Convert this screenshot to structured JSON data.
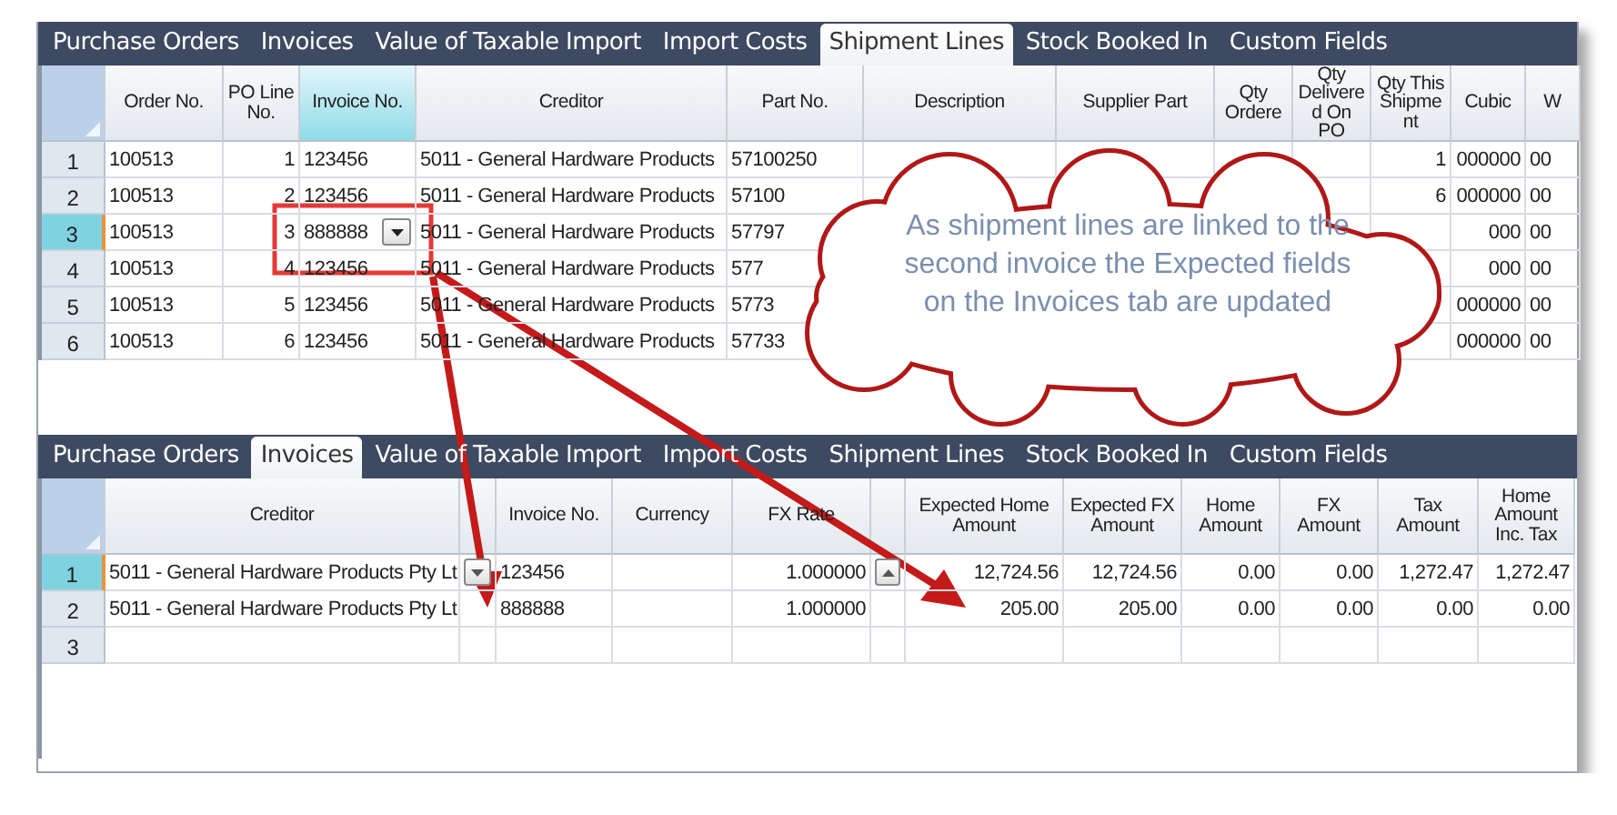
{
  "panels": [
    {
      "tabs": [
        {
          "label": "Purchase Orders",
          "selected": false
        },
        {
          "label": "Invoices",
          "selected": false
        },
        {
          "label": "Value of Taxable Import",
          "selected": false
        },
        {
          "label": "Import Costs",
          "selected": false
        },
        {
          "label": "Shipment Lines",
          "selected": true
        },
        {
          "label": "Stock Booked In",
          "selected": false
        },
        {
          "label": "Custom Fields",
          "selected": false
        }
      ],
      "columns": [
        {
          "header": "Order No.",
          "selected": false
        },
        {
          "header": "PO Line No.",
          "selected": false
        },
        {
          "header": "Invoice No.",
          "selected": true
        },
        {
          "header": "Creditor",
          "selected": false
        },
        {
          "header": "Part No.",
          "selected": false
        },
        {
          "header": "Description",
          "selected": false
        },
        {
          "header": "Supplier Part",
          "selected": false
        },
        {
          "header": "Qty Ordere",
          "selected": false
        },
        {
          "header": "Qty Delivered On PO",
          "selected": false
        },
        {
          "header": "Qty This Shipment",
          "selected": false
        },
        {
          "header": "Cubic",
          "selected": false
        },
        {
          "header": "W",
          "selected": false
        }
      ],
      "rows": [
        {
          "number": "1",
          "selected": false,
          "cells": [
            {
              "text": "100513"
            },
            {
              "text": "1"
            },
            {
              "text": "123456"
            },
            {
              "text": "5011 - General Hardware Products"
            },
            {
              "text": "57100250"
            },
            {},
            {},
            {},
            {},
            {
              "text": "1"
            },
            {
              "text": "000000"
            },
            {
              "text": "00"
            }
          ]
        },
        {
          "number": "2",
          "selected": false,
          "cells": [
            {
              "text": "100513"
            },
            {
              "text": "2"
            },
            {
              "text": "123456"
            },
            {
              "text": "5011 - General Hardware Products"
            },
            {
              "text": "57100"
            },
            {},
            {},
            {},
            {},
            {
              "text": "6"
            },
            {
              "text": "000000"
            },
            {
              "text": "00"
            }
          ]
        },
        {
          "number": "3",
          "selected": true,
          "cells": [
            {
              "text": "100513"
            },
            {
              "text": "3"
            },
            {
              "text": "888888",
              "kind": "combo"
            },
            {
              "text": "5011 - General Hardware Products"
            },
            {
              "text": "57797"
            },
            {},
            {},
            {},
            {},
            {},
            {
              "text": "000"
            },
            {
              "text": "00"
            }
          ]
        },
        {
          "number": "4",
          "selected": false,
          "cells": [
            {
              "text": "100513"
            },
            {
              "text": "4"
            },
            {
              "text": "123456"
            },
            {
              "text": "5011 - General Hardware Products"
            },
            {
              "text": "577"
            },
            {},
            {},
            {},
            {},
            {},
            {
              "text": "000"
            },
            {
              "text": "00"
            }
          ]
        },
        {
          "number": "5",
          "selected": false,
          "cells": [
            {
              "text": "100513"
            },
            {
              "text": "5"
            },
            {
              "text": "123456"
            },
            {
              "text": "5011 - General Hardware Products"
            },
            {
              "text": "5773"
            },
            {},
            {},
            {},
            {},
            {},
            {
              "text": "000000"
            },
            {
              "text": "00"
            }
          ]
        },
        {
          "number": "6",
          "selected": false,
          "cells": [
            {
              "text": "100513"
            },
            {
              "text": "6"
            },
            {
              "text": "123456"
            },
            {
              "text": "5011 - General Hardware Products"
            },
            {
              "text": "57733"
            },
            {},
            {},
            {},
            {},
            {},
            {
              "text": "000000"
            },
            {
              "text": "00"
            }
          ]
        }
      ]
    },
    {
      "tabs": [
        {
          "label": "Purchase Orders",
          "selected": false
        },
        {
          "label": "Invoices",
          "selected": true
        },
        {
          "label": "Value of Taxable Import",
          "selected": false
        },
        {
          "label": "Import Costs",
          "selected": false
        },
        {
          "label": "Shipment Lines",
          "selected": false
        },
        {
          "label": "Stock Booked In",
          "selected": false
        },
        {
          "label": "Custom Fields",
          "selected": false
        }
      ],
      "columns": [
        {
          "header": "Creditor",
          "selected": false
        },
        {
          "selected": false
        },
        {
          "header": "Invoice No.",
          "selected": false
        },
        {
          "header": "Currency",
          "selected": false
        },
        {
          "header": "FX Rate",
          "selected": false
        },
        {
          "selected": false
        },
        {
          "header": "Expected Home Amount",
          "selected": false
        },
        {
          "header": "Expected FX Amount",
          "selected": false
        },
        {
          "header": "Home Amount",
          "selected": false
        },
        {
          "header": "FX Amount",
          "selected": false
        },
        {
          "header": "Tax Amount",
          "selected": false
        },
        {
          "header": "Home Amount Inc. Tax",
          "selected": false
        }
      ],
      "rows": [
        {
          "number": "1",
          "selected": true,
          "cells": [
            {
              "text": "5011 - General Hardware Products Pty Lt"
            },
            {
              "kind": "dropdown"
            },
            {
              "text": "123456"
            },
            {},
            {
              "text": "1.000000"
            },
            {
              "kind": "scroll-up"
            },
            {
              "text": "12,724.56"
            },
            {
              "text": "12,724.56"
            },
            {
              "text": "0.00"
            },
            {
              "text": "0.00"
            },
            {
              "text": "1,272.47"
            },
            {
              "text": "1,272.47"
            }
          ]
        },
        {
          "number": "2",
          "selected": false,
          "cells": [
            {
              "text": "5011 - General Hardware Products Pty Lt"
            },
            {},
            {
              "text": "888888"
            },
            {},
            {
              "text": "1.000000"
            },
            {},
            {
              "text": "205.00"
            },
            {
              "text": "205.00"
            },
            {
              "text": "0.00"
            },
            {
              "text": "0.00"
            },
            {
              "text": "0.00"
            },
            {
              "text": "0.00"
            }
          ]
        },
        {
          "number": "3",
          "selected": false,
          "cells": [
            {},
            {},
            {},
            {},
            {},
            {},
            {},
            {},
            {},
            {},
            {},
            {}
          ]
        }
      ]
    }
  ],
  "callout": {
    "text": "As shipment lines are linked to the second invoice the Expected fields on the Invoices tab are updated"
  }
}
